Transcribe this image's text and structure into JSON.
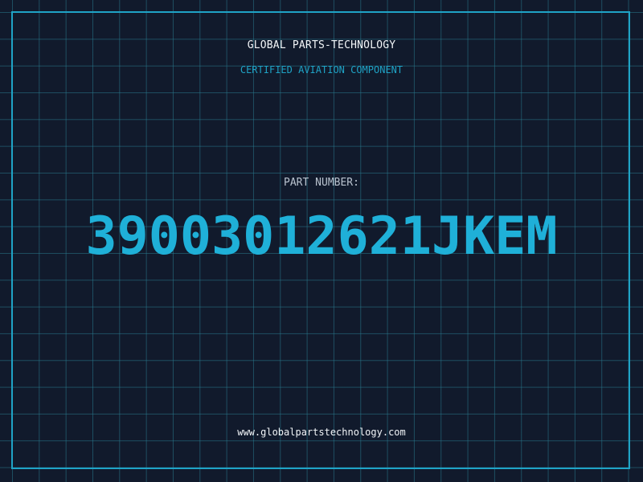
{
  "header": {
    "company": "GLOBAL PARTS-TECHNOLOGY",
    "subtitle": "CERTIFIED AVIATION COMPONENT"
  },
  "part": {
    "label": "PART NUMBER:",
    "number": "39003012621JKEM"
  },
  "footer": {
    "website": "www.globalpartstechnology.com"
  },
  "colors": {
    "background": "#111a2c",
    "accent": "#1fb0d8",
    "grid": "#28788c",
    "text": "#f2f5f8"
  }
}
